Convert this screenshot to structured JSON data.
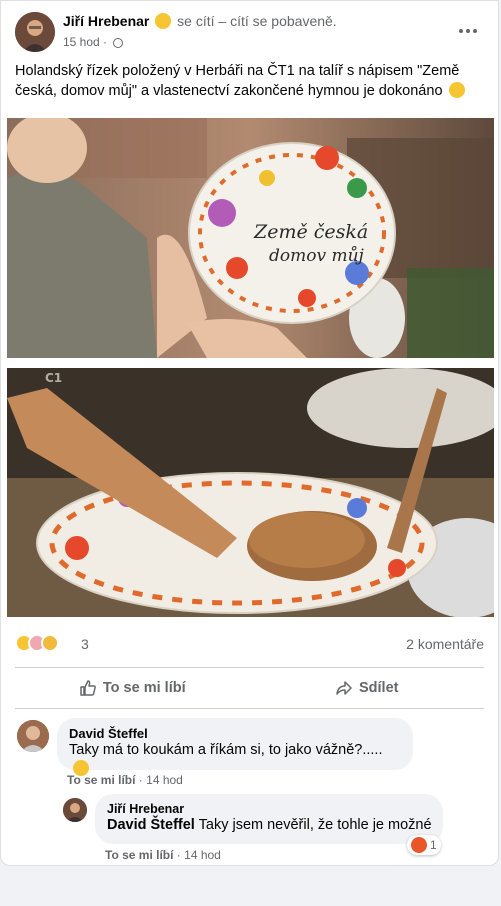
{
  "post": {
    "author": "Jiří Hrebenar",
    "feeling": "se cítí – cítí se pobaveně.",
    "time": "15 hod",
    "text": "Holandský řízek položený v Herbáři na ČT1 na talíř  s nápisem \"Země česká, domov můj\" a vlastenectví zakončené hymnou je dokonáno",
    "photo1_plate_text_line1": "Země česká",
    "photo1_plate_text_line2": "domov můj",
    "photo2_watermark": "Ⅽ1"
  },
  "reactions": {
    "count": "3",
    "comments": "2 komentáře",
    "icons": [
      "haha-icon",
      "love-icon",
      "sad-icon"
    ]
  },
  "actions": {
    "like": "To se mi líbí",
    "share": "Sdílet"
  },
  "comments": [
    {
      "author": "David Šteffel",
      "text": "Taky má to koukám a říkám si, to jako vážně?.....",
      "like_label": "To se mi líbí",
      "time": "14 hod"
    },
    {
      "author": "Jiří Hrebenar",
      "tag": "David Šteffel",
      "text": "Taky jsem nevěřil, že tohle je možné",
      "like_label": "To se mi líbí",
      "time": "14 hod",
      "reaction_count": "1"
    }
  ],
  "colors": {
    "text": "#050505",
    "secondary": "#65676b",
    "bubble": "#f0f2f5",
    "emoji": "#f7c531",
    "angry": "#e8562a"
  }
}
